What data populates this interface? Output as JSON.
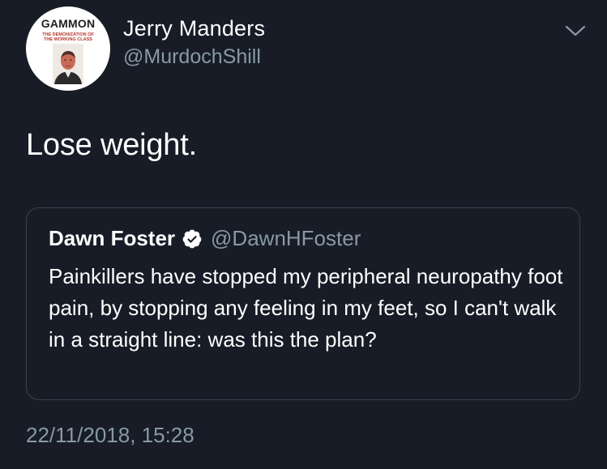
{
  "author": {
    "name": "Jerry Manders",
    "handle": "@MurdochShill",
    "avatar": {
      "brand": "GAMMON",
      "subtitle": "THE DEMONIZATION OF THE WORKING CLASS"
    }
  },
  "tweet": {
    "text": "Lose weight.",
    "timestamp": "22/11/2018, 15:28"
  },
  "quoted_tweet": {
    "name": "Dawn Foster",
    "handle": "@DawnHFoster",
    "verified": true,
    "text": "Painkillers have stopped my peripheral neuropathy foot pain, by stopping any feeling in my feet, so I can't walk in a straight line: was this the plan?"
  },
  "colors": {
    "background": "#171c26",
    "primary_text": "#ffffff",
    "secondary_text": "#8899a6",
    "card_border": "#38444d"
  },
  "icons": {
    "menu": "chevron-down-icon",
    "verified": "verified-badge-icon"
  }
}
